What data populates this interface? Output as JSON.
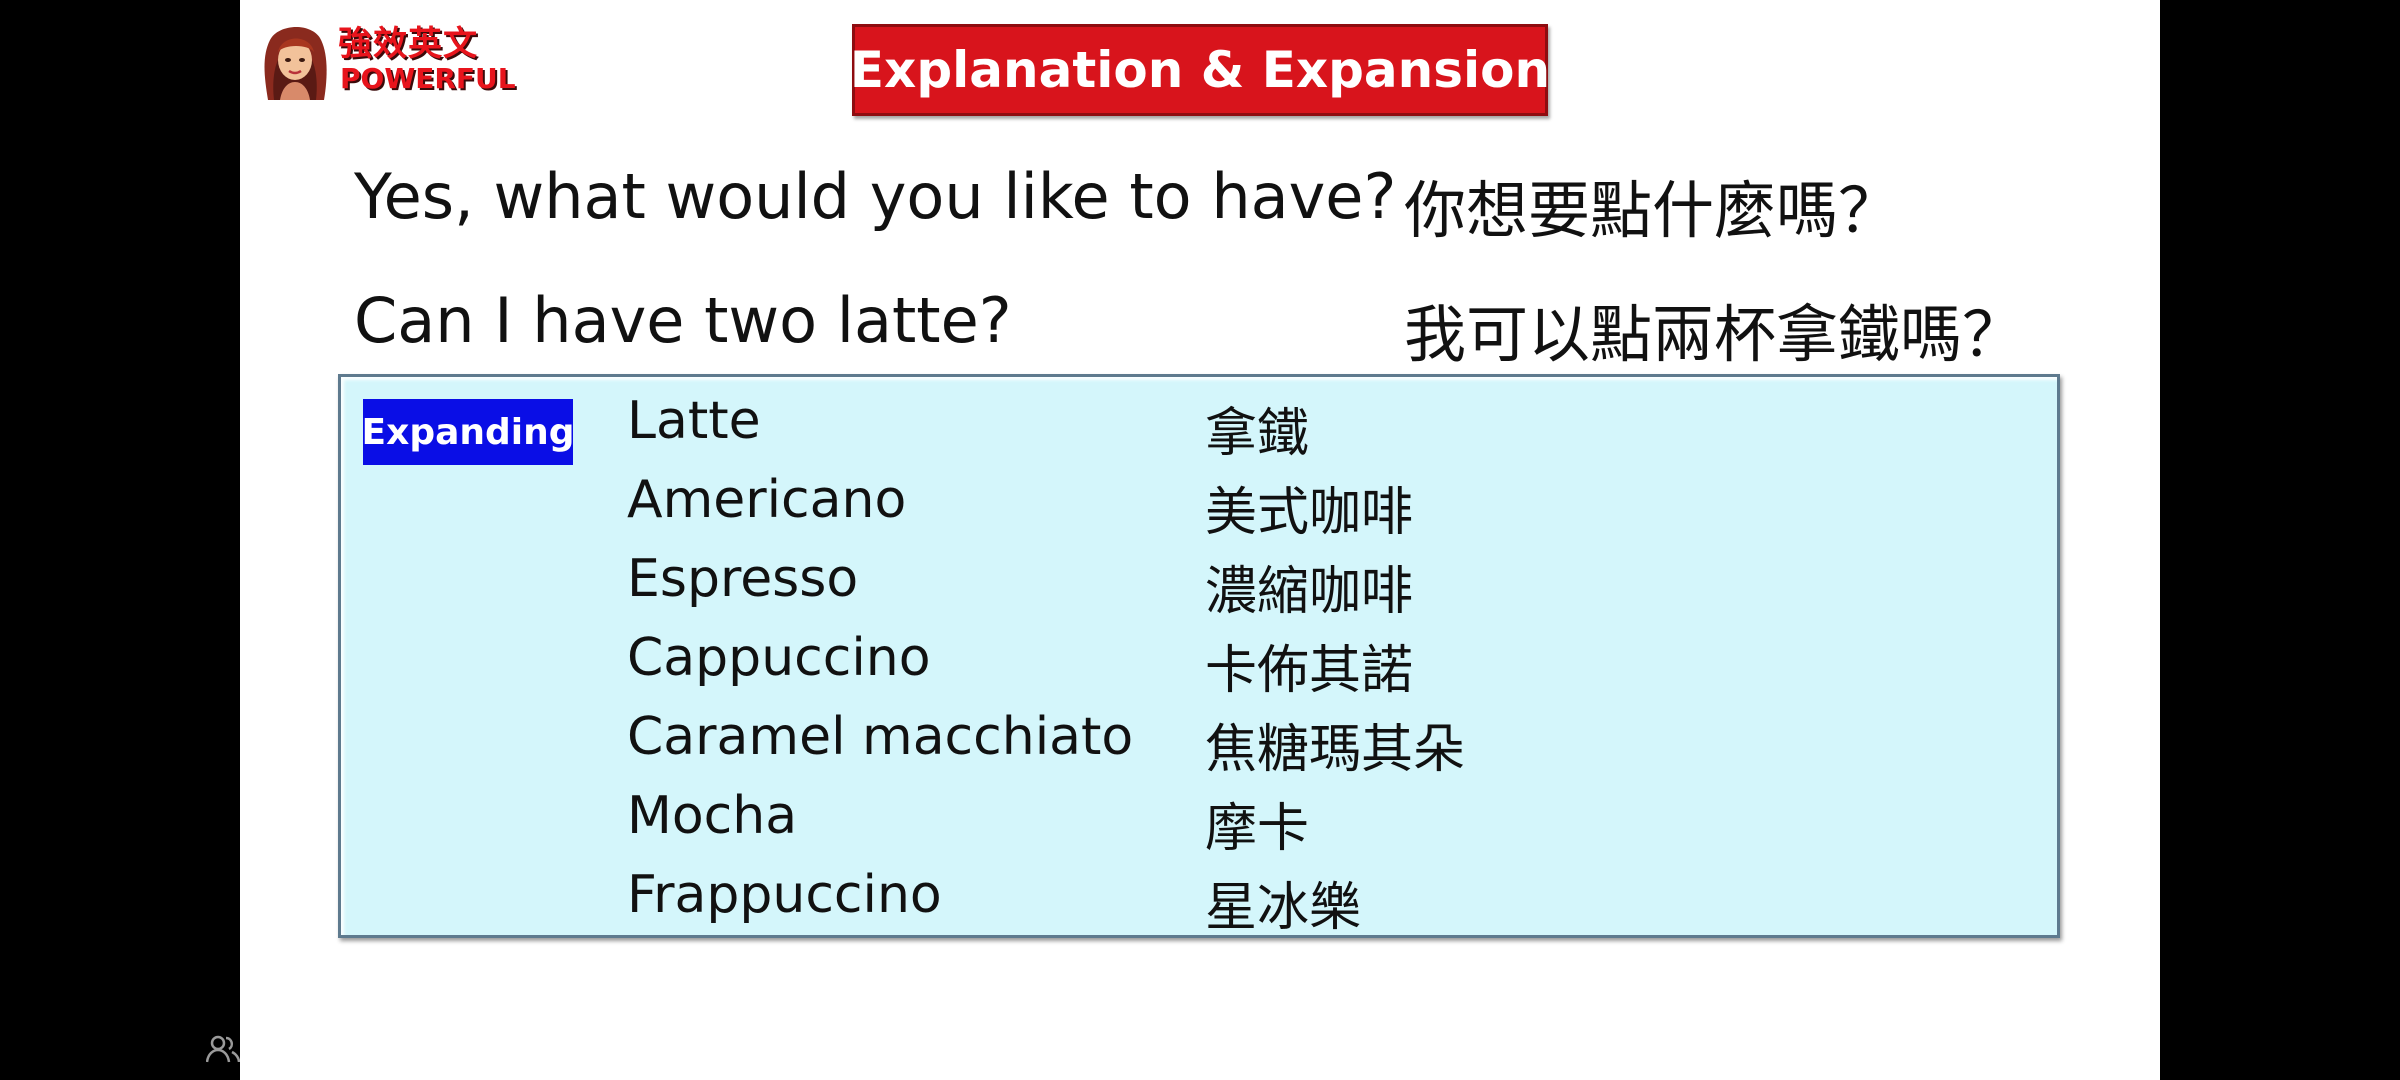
{
  "slide": {
    "logo": {
      "chinese": "強效英文",
      "english": "POWERFUL"
    },
    "title": "Explanation & Expansion",
    "lines": [
      {
        "english": "Yes, what would you like to have?",
        "chinese": "你想要點什麼嗎？"
      },
      {
        "english": "Can I have two latte?",
        "chinese": "我可以點兩杯拿鐵嗎？"
      }
    ],
    "expanding": {
      "badge": "Expanding",
      "items": [
        {
          "english": "Latte",
          "chinese": "拿鐵"
        },
        {
          "english": "Americano",
          "chinese": "美式咖啡"
        },
        {
          "english": "Espresso",
          "chinese": "濃縮咖啡"
        },
        {
          "english": "Cappuccino",
          "chinese": "卡佈其諾"
        },
        {
          "english": "Caramel macchiato",
          "chinese": "焦糖瑪其朵"
        },
        {
          "english": "Mocha",
          "chinese": "摩卡"
        },
        {
          "english": "Frappuccino",
          "chinese": "星冰樂"
        }
      ]
    }
  },
  "colors": {
    "title_bg": "#d8141c",
    "box_bg": "#d4f6fb",
    "badge_bg": "#0a0ee6",
    "logo_text": "#e8141c"
  },
  "icons": {
    "corner": "people-icon",
    "logo": "girl-avatar-icon"
  }
}
